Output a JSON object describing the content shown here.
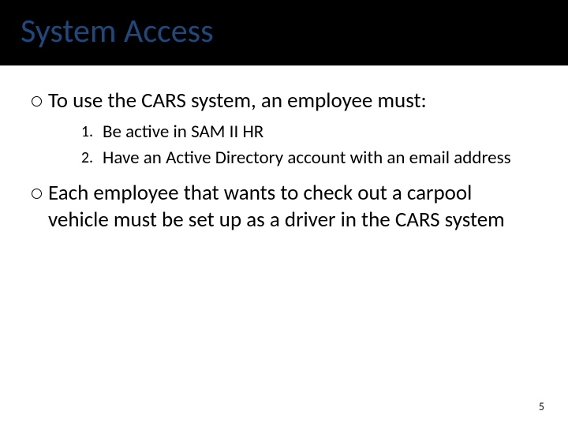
{
  "title": "System Access",
  "bullets": [
    {
      "text": "To use the CARS system, an employee must:"
    },
    {
      "text": "Each employee that wants to check out a carpool vehicle must be set up as a driver in the CARS system"
    }
  ],
  "numbered": [
    {
      "n": "1.",
      "text": "Be active in SAM II HR"
    },
    {
      "n": "2.",
      "text": "Have an Active Directory account with an email address"
    }
  ],
  "page_number": "5"
}
